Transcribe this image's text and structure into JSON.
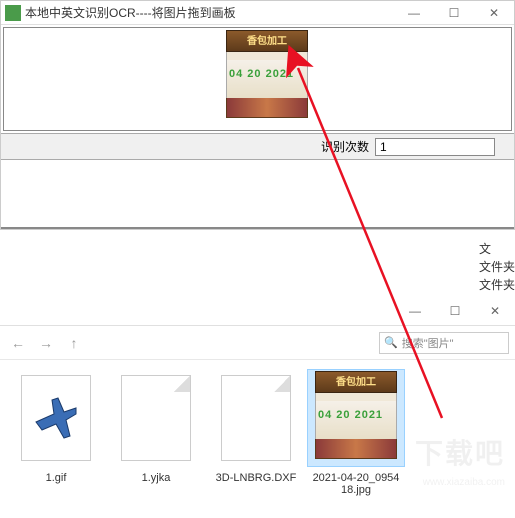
{
  "ocr": {
    "title": "本地中英文识别OCR----将图片拖到画板",
    "thumb_header": "香包加工",
    "thumb_date": "04 20 2021",
    "counter_label": "识别次数",
    "counter_value": "1"
  },
  "side_labels": {
    "l1": "文",
    "l2": "文件夹",
    "l3": "文件夹"
  },
  "explorer": {
    "search_placeholder": "搜索\"图片\"",
    "files": [
      {
        "name": "1.gif"
      },
      {
        "name": "1.yjka"
      },
      {
        "name": "3D-LNBRG.DXF"
      },
      {
        "name": "2021-04-20_095418.jpg"
      }
    ]
  },
  "watermark": {
    "big": "下载吧",
    "url": "www.xiazaiba.com"
  }
}
